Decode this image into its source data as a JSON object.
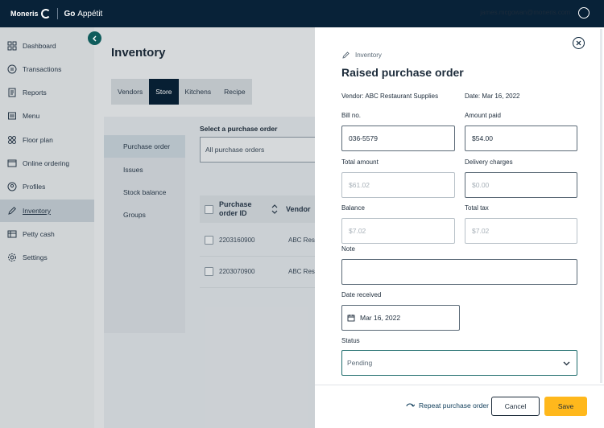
{
  "header": {
    "logo_text": "Moneris",
    "brand_bold": "Go",
    "brand_rest": "Appétit",
    "user_email": "james.mcgowan@moneris.com"
  },
  "sidebar": {
    "items": [
      {
        "label": "Dashboard",
        "icon": "dashboard-icon"
      },
      {
        "label": "Transactions",
        "icon": "transactions-icon"
      },
      {
        "label": "Reports",
        "icon": "reports-icon"
      },
      {
        "label": "Menu",
        "icon": "menu-icon"
      },
      {
        "label": "Floor plan",
        "icon": "floor-plan-icon"
      },
      {
        "label": "Online ordering",
        "icon": "online-ordering-icon"
      },
      {
        "label": "Profiles",
        "icon": "profiles-icon"
      },
      {
        "label": "Inventory",
        "icon": "inventory-icon",
        "active": true
      },
      {
        "label": "Petty cash",
        "icon": "petty-cash-icon"
      },
      {
        "label": "Settings",
        "icon": "settings-icon"
      }
    ]
  },
  "page": {
    "title": "Inventory",
    "tabs": [
      "Vendors",
      "Store",
      "Kitchens",
      "Recipe"
    ],
    "active_tab": "Store",
    "subnav": [
      "Purchase order",
      "Issues",
      "Stock balance",
      "Groups"
    ],
    "select_label": "Select a purchase order",
    "select_value": "All purchase orders",
    "table": {
      "col_po": "Purchase order ID",
      "col_vendor": "Vendor",
      "rows": [
        {
          "id": "2203160900",
          "vendor": "ABC Resta"
        },
        {
          "id": "2203070900",
          "vendor": "ABC Resta"
        }
      ]
    }
  },
  "panel": {
    "breadcrumb": "Inventory",
    "title": "Raised purchase order",
    "vendor": "Vendor: ABC Restaurant Supplies",
    "date": "Date: Mar 16, 2022",
    "bill_label": "Bill no.",
    "bill_value": "036-5579",
    "amount_paid_label": "Amount paid",
    "amount_paid_value": "$54.00",
    "total_amount_label": "Total amount",
    "total_amount_value": "$61.02",
    "delivery_label": "Delivery charges",
    "delivery_value": "$0.00",
    "balance_label": "Balance",
    "balance_value": "$7.02",
    "total_tax_label": "Total tax",
    "total_tax_value": "$7.02",
    "note_label": "Note",
    "note_value": "",
    "date_received_label": "Date received",
    "date_received_value": "Mar 16, 2022",
    "status_label": "Status",
    "status_value": "Pending",
    "repeat_label": "Repeat purchase order",
    "cancel_label": "Cancel",
    "save_label": "Save"
  },
  "colors": {
    "topbar": "#082238",
    "accent_teal": "#0f5c5c",
    "save_yellow": "#ffb81c"
  }
}
